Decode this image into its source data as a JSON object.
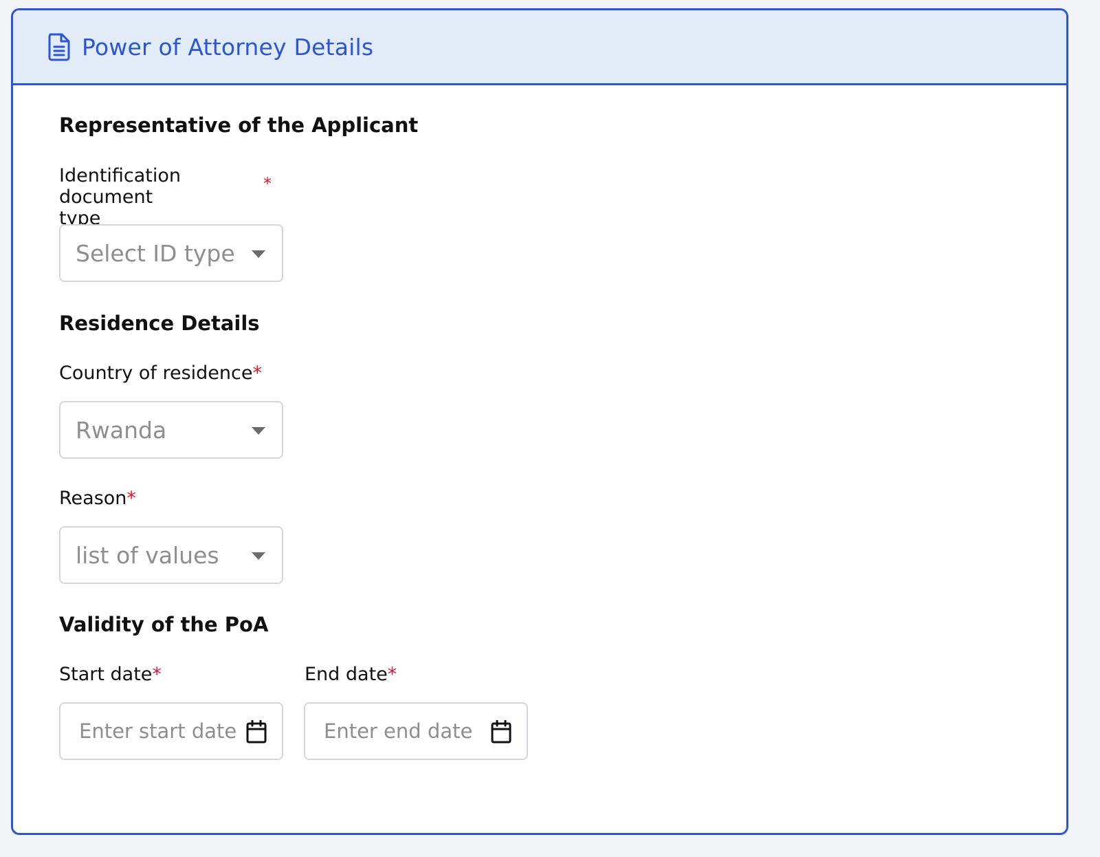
{
  "header": {
    "title": "Power of Attorney Details",
    "icon": "document-icon"
  },
  "sections": {
    "representative": {
      "title": "Representative of the Applicant",
      "id_type": {
        "label": "Identification document type",
        "required_mark": "*",
        "placeholder": "Select ID type"
      }
    },
    "residence": {
      "title": "Residence Details",
      "country": {
        "label": "Country of residence",
        "required_mark": "*",
        "value": "Rwanda"
      },
      "reason": {
        "label": "Reason",
        "required_mark": "*",
        "placeholder": "list of values"
      }
    },
    "validity": {
      "title": "Validity of the PoA",
      "start_date": {
        "label": "Start date",
        "required_mark": "*",
        "placeholder": "Enter start date"
      },
      "end_date": {
        "label": "End date",
        "required_mark": "*",
        "placeholder": "Enter end date"
      }
    }
  },
  "colors": {
    "accent": "#2a55d6",
    "header_bg": "#e2ecf8",
    "required": "#e0182d",
    "placeholder": "#8e8e8e"
  }
}
